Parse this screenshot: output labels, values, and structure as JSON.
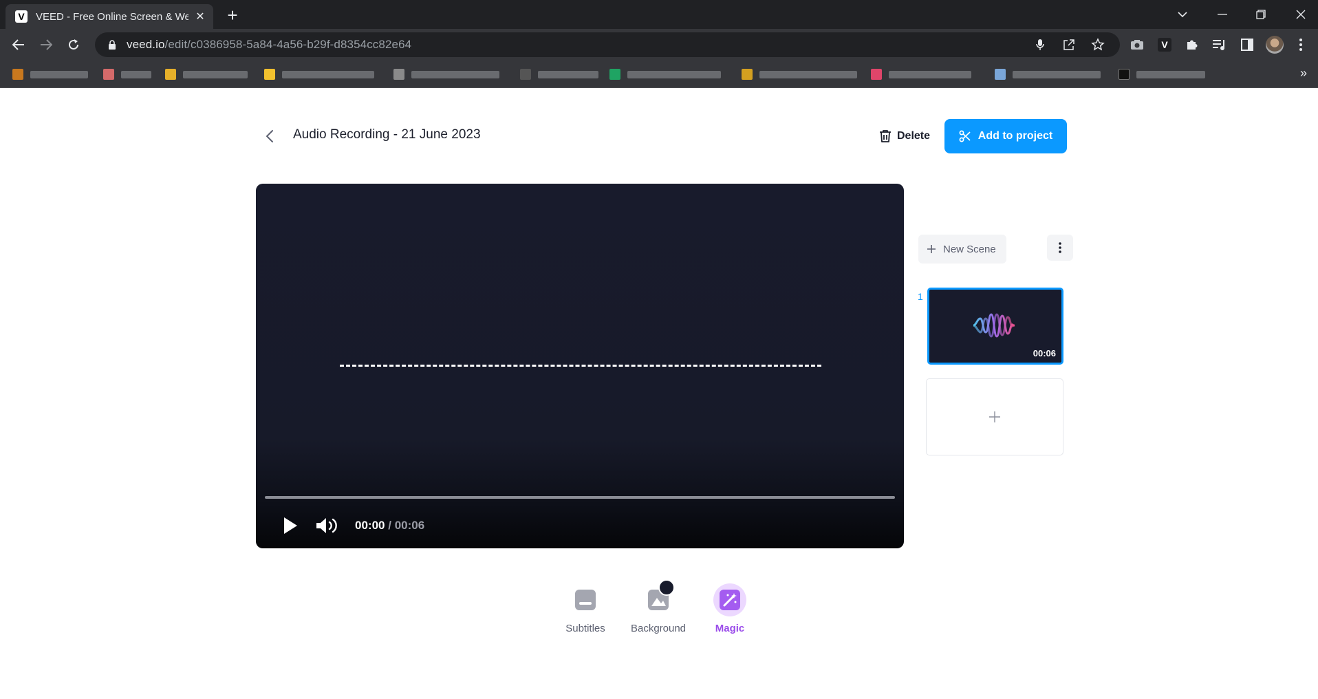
{
  "browser": {
    "tab_title": "VEED - Free Online Screen & Webcam Recorder",
    "tab_favicon_letter": "V",
    "url_host": "veed.io",
    "url_path": "/edit/c0386958-5a84-4a56-b29f-d8354cc82e64",
    "bookmarks_more": "»",
    "colors": {
      "frame": "#202124",
      "toolbar": "#35363a"
    }
  },
  "header": {
    "title": "Audio Recording - 21 June 2023",
    "delete_label": "Delete",
    "add_label": "Add to project"
  },
  "player": {
    "current_time": "00:00",
    "separator": "/",
    "total_time": "00:06",
    "progress_fraction": 0.0
  },
  "scenes": {
    "new_scene_label": "New Scene",
    "items": [
      {
        "number": "1",
        "duration": "00:06"
      }
    ]
  },
  "tools": {
    "subtitles_label": "Subtitles",
    "background_label": "Background",
    "magic_label": "Magic"
  },
  "colors": {
    "accent": "#0b99ff",
    "magic": "#9b4dea",
    "player_bg": "#181b2c"
  }
}
